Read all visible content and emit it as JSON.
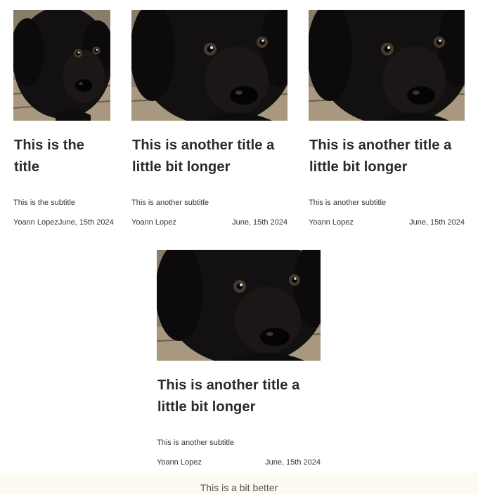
{
  "cards": [
    {
      "image_alt": "black labrador puppy photo",
      "title": "This is the title",
      "subtitle": "This is the subtitle",
      "author": "Yoann Lopez",
      "date": "June, 15th 2024"
    },
    {
      "image_alt": "black labrador puppy photo",
      "title": "This is another title a little bit longer",
      "subtitle": "This is another subtitle",
      "author": "Yoann Lopez",
      "date": "June, 15th 2024"
    },
    {
      "image_alt": "black labrador puppy photo",
      "title": "This is another title a little bit longer",
      "subtitle": "This is another subtitle",
      "author": "Yoann Lopez",
      "date": "June, 15th 2024"
    },
    {
      "image_alt": "black labrador puppy photo",
      "title": "This is another title a little bit longer",
      "subtitle": "This is another subtitle",
      "author": "Yoann Lopez",
      "date": "June, 15th 2024"
    }
  ],
  "footer": {
    "text": "This is a bit better"
  },
  "colors": {
    "title": "#2a2a2a",
    "text": "#333333",
    "footer_bg": "#fdfaf2"
  }
}
